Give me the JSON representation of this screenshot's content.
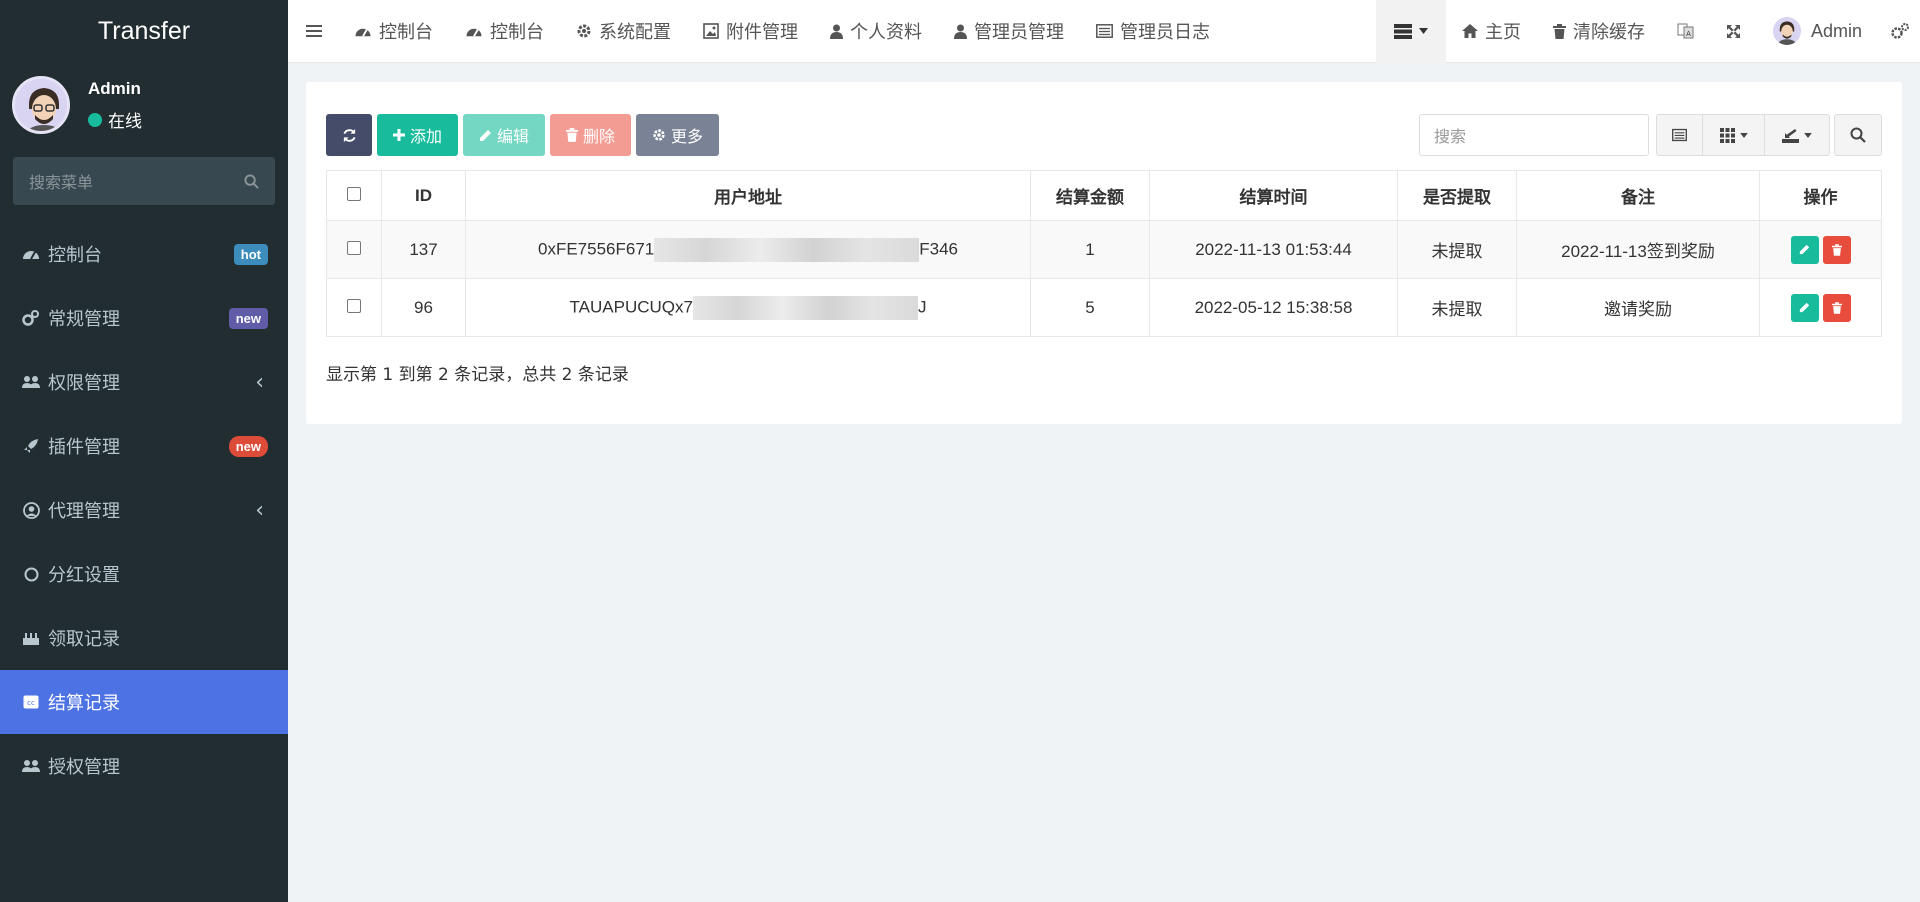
{
  "brand": "Transfer",
  "user": {
    "name": "Admin",
    "status": "在线"
  },
  "sidebar": {
    "search_placeholder": "搜索菜单",
    "items": [
      {
        "label": "控制台",
        "badge": "hot",
        "badge_color": "#3c8dbc"
      },
      {
        "label": "常规管理",
        "badge": "new",
        "badge_color": "#605ca8"
      },
      {
        "label": "权限管理"
      },
      {
        "label": "插件管理",
        "badge": "new",
        "badge_color": "#dd4b39"
      },
      {
        "label": "代理管理"
      },
      {
        "label": "分红设置"
      },
      {
        "label": "领取记录"
      },
      {
        "label": "结算记录",
        "active": true
      },
      {
        "label": "授权管理"
      }
    ]
  },
  "topbar": {
    "tabs": [
      "控制台",
      "控制台",
      "系统配置",
      "附件管理",
      "个人资料",
      "管理员管理",
      "管理员日志"
    ],
    "home": "主页",
    "clear_cache": "清除缓存",
    "user": "Admin"
  },
  "toolbar": {
    "add": "添加",
    "edit": "编辑",
    "delete": "删除",
    "more": "更多",
    "search_placeholder": "搜索"
  },
  "table": {
    "headers": [
      "ID",
      "用户地址",
      "结算金额",
      "结算时间",
      "是否提取",
      "备注",
      "操作"
    ],
    "rows": [
      {
        "id": "137",
        "addr_start": "0xFE7556F671",
        "addr_end": "F346",
        "amount": "1",
        "time": "2022-11-13 01:53:44",
        "extracted": "未提取",
        "remark": "2022-11-13签到奖励"
      },
      {
        "id": "96",
        "addr_start": "TAUAPUCUQx7",
        "addr_end": "J",
        "amount": "5",
        "time": "2022-05-12 15:38:58",
        "extracted": "未提取",
        "remark": "邀请奖励"
      }
    ]
  },
  "pagination_text": "显示第 1 到第 2 条记录，总共 2 条记录",
  "colors": {
    "sidebar_bg": "#222d32",
    "active": "#4d72e3",
    "success": "#18bc9c",
    "danger": "#e74c3c"
  }
}
